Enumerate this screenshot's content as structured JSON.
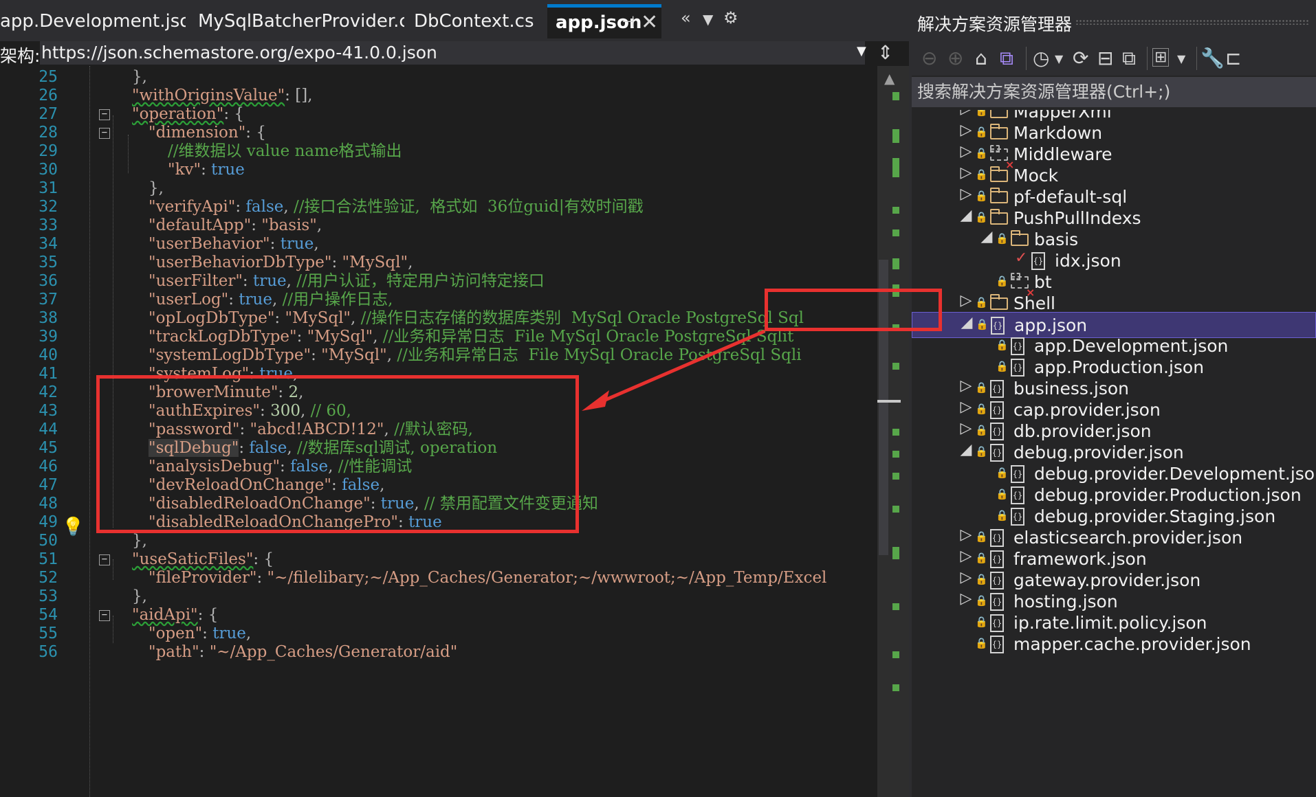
{
  "editor_tabs": [
    {
      "label": "app.Development.json",
      "active": false
    },
    {
      "label": "MySqlBatcherProvider.cs",
      "active": false
    },
    {
      "label": "DbContext.cs",
      "active": false
    },
    {
      "label": "app.json",
      "active": true
    }
  ],
  "strip_icons": {
    "scroll": "double-chevron-left-icon",
    "dropdown": "dropdown-icon",
    "settings": "gear-icon"
  },
  "schema": {
    "label": "架构:",
    "url": "https://json.schemastore.org/expo-41.0.0.json"
  },
  "code_lines": [
    {
      "num": "25"
    },
    {
      "num": "26"
    },
    {
      "num": "27"
    },
    {
      "num": "28"
    },
    {
      "num": "29"
    },
    {
      "num": "30"
    },
    {
      "num": "31"
    },
    {
      "num": "32"
    },
    {
      "num": "33"
    },
    {
      "num": "34"
    },
    {
      "num": "35"
    },
    {
      "num": "36"
    },
    {
      "num": "37"
    },
    {
      "num": "38"
    },
    {
      "num": "39"
    },
    {
      "num": "40"
    },
    {
      "num": "41"
    },
    {
      "num": "42"
    },
    {
      "num": "43"
    },
    {
      "num": "44"
    },
    {
      "num": "45"
    },
    {
      "num": "46"
    },
    {
      "num": "47"
    },
    {
      "num": "48"
    },
    {
      "num": "49"
    },
    {
      "num": "50"
    },
    {
      "num": "51"
    },
    {
      "num": "52"
    },
    {
      "num": "53"
    },
    {
      "num": "54"
    },
    {
      "num": "55"
    },
    {
      "num": "56"
    }
  ],
  "code": {
    "l25": "},",
    "l26_key": "\"withOriginsValue\"",
    "l26_rest": ": [],",
    "l27_key": "\"operation\"",
    "l27_rest": ": {",
    "l28_key": "\"dimension\"",
    "l28_rest": ": {",
    "l29_comment": "//维数据以 value name格式输出",
    "l30_key": "\"kv\"",
    "l30_colon": ": ",
    "l30_val": "true",
    "l31": "},",
    "l32_key": "\"verifyApi\"",
    "l32_colon": ": ",
    "l32_val": "false",
    "l32_comma": ", ",
    "l32_comment": "//接口合法性验证,  格式如  36位guid|有效时间戳",
    "l33_key": "\"defaultApp\"",
    "l33_colon": ": ",
    "l33_val": "\"basis\"",
    "l33_comma": ",",
    "l34_key": "\"userBehavior\"",
    "l34_colon": ": ",
    "l34_val": "true",
    "l34_comma": ",",
    "l35_key": "\"userBehaviorDbType\"",
    "l35_colon": ": ",
    "l35_val": "\"MySql\"",
    "l35_comma": ",",
    "l36_key": "\"userFilter\"",
    "l36_colon": ": ",
    "l36_val": "true",
    "l36_comma": ", ",
    "l36_comment": "//用户认证，特定用户访问特定接口",
    "l37_key": "\"userLog\"",
    "l37_colon": ": ",
    "l37_val": "true",
    "l37_comma": ", ",
    "l37_comment": "//用户操作日志,",
    "l38_key": "\"opLogDbType\"",
    "l38_colon": ": ",
    "l38_val": "\"MySql\"",
    "l38_comma": ", ",
    "l38_comment": "//操作日志存储的数据库类别  MySql Oracle PostgreSql Sql",
    "l39_key": "\"trackLogDbType\"",
    "l39_colon": ": ",
    "l39_val": "\"MySql\"",
    "l39_comma": ", ",
    "l39_comment": "//业务和异常日志  File MySql Oracle PostgreSql Sqlit",
    "l40_key": "\"systemLogDbType\"",
    "l40_colon": ": ",
    "l40_val": "\"MySql\"",
    "l40_comma": ", ",
    "l40_comment": "//业务和异常日志  File MySql Oracle PostgreSql Sqli",
    "l41_key": "\"systemLog\"",
    "l41_colon": ": ",
    "l41_val": "true",
    "l41_comma": ",",
    "l42_key": "\"browerMinute\"",
    "l42_colon": ": ",
    "l42_val": "2",
    "l42_comma": ",",
    "l43_key": "\"authExpires\"",
    "l43_colon": ": ",
    "l43_val": "300",
    "l43_comma": ", ",
    "l43_comment": "// 60,",
    "l44_key": "\"password\"",
    "l44_colon": ": ",
    "l44_val": "\"abcd!ABCD!12\"",
    "l44_comma": ", ",
    "l44_comment": "//默认密码,",
    "l45_key": "\"sqlDebug\"",
    "l45_colon": ": ",
    "l45_val": "false",
    "l45_comma": ", ",
    "l45_comment": "//数据库sql调试, operation",
    "l46_key": "\"analysisDebug\"",
    "l46_colon": ": ",
    "l46_val": "false",
    "l46_comma": ", ",
    "l46_comment": "//性能调试",
    "l47_key": "\"devReloadOnChange\"",
    "l47_colon": ": ",
    "l47_val": "false",
    "l47_comma": ",",
    "l48_key": "\"disabledReloadOnChange\"",
    "l48_colon": ": ",
    "l48_val": "true",
    "l48_comma": ", ",
    "l48_comment": "// 禁用配置文件变更通知",
    "l49_key": "\"disabledReloadOnChangePro\"",
    "l49_colon": ": ",
    "l49_val": "true",
    "l50": "},",
    "l51_key": "\"useSaticFiles\"",
    "l51_rest": ": {",
    "l52_key": "\"fileProvider\"",
    "l52_colon": ": ",
    "l52_val": "\"~/filelibary;~/App_Caches/Generator;~/wwwroot;~/App_Temp/Excel",
    "l53": "},",
    "l54_key": "\"aidApi\"",
    "l54_rest": ": {",
    "l55_key": "\"open\"",
    "l55_colon": ": ",
    "l55_val": "true",
    "l55_comma": ",",
    "l56_key": "\"path\"",
    "l56_colon": ": ",
    "l56_val": "\"~/App_Caches/Generator/aid\""
  },
  "solution_explorer": {
    "title": "解决方案资源管理器",
    "search_placeholder": "搜索解决方案资源管理器(Ctrl+;)",
    "toolbar_icons": [
      "back-icon",
      "forward-icon",
      "home-icon",
      "vs-icon",
      "history-icon",
      "dropdown-icon",
      "refresh-icon",
      "collapse-all-icon",
      "copy-icon",
      "switch-view-icon",
      "dropdown-icon",
      "properties-wrench-icon",
      "preview-icon"
    ],
    "nodes": [
      {
        "label": "MapperXml",
        "type": "folder",
        "arrow": "▷",
        "indent": 0
      },
      {
        "label": "Markdown",
        "type": "folder",
        "arrow": "▷",
        "indent": 0
      },
      {
        "label": "Middleware",
        "type": "folder-missing",
        "arrow": "▷",
        "indent": 0
      },
      {
        "label": "Mock",
        "type": "folder",
        "arrow": "▷",
        "indent": 0
      },
      {
        "label": "pf-default-sql",
        "type": "folder",
        "arrow": "▷",
        "indent": 0
      },
      {
        "label": "PushPullIndexs",
        "type": "folder-open",
        "arrow": "◢",
        "indent": 0
      },
      {
        "label": "basis",
        "type": "folder-open",
        "arrow": "◢",
        "indent": 1
      },
      {
        "label": "idx.json",
        "type": "json-checked",
        "arrow": "",
        "indent": 2
      },
      {
        "label": "bt",
        "type": "folder-missing",
        "arrow": "",
        "indent": 1
      },
      {
        "label": "Shell",
        "type": "folder",
        "arrow": "▷",
        "indent": 0
      },
      {
        "label": "app.json",
        "type": "json",
        "arrow": "◢",
        "indent": 0,
        "selected": true
      },
      {
        "label": "app.Development.json",
        "type": "json",
        "arrow": "",
        "indent": 1
      },
      {
        "label": "app.Production.json",
        "type": "json",
        "arrow": "",
        "indent": 1
      },
      {
        "label": "business.json",
        "type": "json",
        "arrow": "▷",
        "indent": 0
      },
      {
        "label": "cap.provider.json",
        "type": "json",
        "arrow": "▷",
        "indent": 0
      },
      {
        "label": "db.provider.json",
        "type": "json",
        "arrow": "▷",
        "indent": 0
      },
      {
        "label": "debug.provider.json",
        "type": "json",
        "arrow": "◢",
        "indent": 0
      },
      {
        "label": "debug.provider.Development.json",
        "type": "json",
        "arrow": "",
        "indent": 1
      },
      {
        "label": "debug.provider.Production.json",
        "type": "json",
        "arrow": "",
        "indent": 1
      },
      {
        "label": "debug.provider.Staging.json",
        "type": "json",
        "arrow": "",
        "indent": 1
      },
      {
        "label": "elasticsearch.provider.json",
        "type": "json",
        "arrow": "▷",
        "indent": 0
      },
      {
        "label": "framework.json",
        "type": "json",
        "arrow": "▷",
        "indent": 0
      },
      {
        "label": "gateway.provider.json",
        "type": "json",
        "arrow": "▷",
        "indent": 0
      },
      {
        "label": "hosting.json",
        "type": "json",
        "arrow": "▷",
        "indent": 0
      },
      {
        "label": "ip.rate.limit.policy.json",
        "type": "json",
        "arrow": "",
        "indent": 0
      },
      {
        "label": "mapper.cache.provider.json",
        "type": "json",
        "arrow": "",
        "indent": 0
      }
    ]
  },
  "colors": {
    "annotation_red": "#e8312f",
    "selection": "#3e3773",
    "accent": "#007acc"
  }
}
